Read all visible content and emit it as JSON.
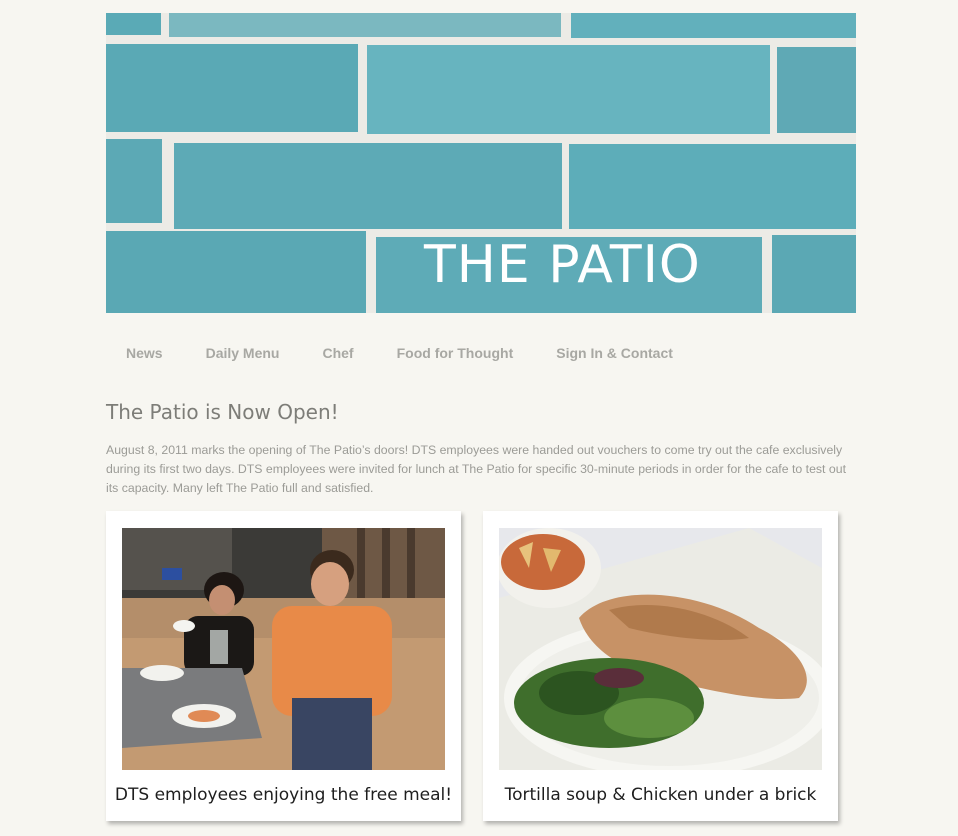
{
  "header": {
    "banner_title": "THE PATIO"
  },
  "nav": {
    "items": [
      {
        "label": "News"
      },
      {
        "label": "Daily Menu"
      },
      {
        "label": "Chef"
      },
      {
        "label": "Food for Thought"
      },
      {
        "label": "Sign In & Contact"
      }
    ]
  },
  "post": {
    "title": "The Patio is Now Open!",
    "body": "August 8, 2011 marks the opening of The Patio’s doors! DTS employees were handed out vouchers to come try out the cafe exclusively during its first two days. DTS employees were invited for lunch at The Patio for specific 30-minute periods in order for the cafe to test out its capacity. Many left The Patio full and satisfied."
  },
  "photos": [
    {
      "caption": "DTS employees enjoying the free meal!"
    },
    {
      "caption": "Tortilla soup & Chicken under a brick"
    }
  ],
  "colors": {
    "background": "#f7f6f1",
    "brick": "#5fb0bd",
    "mortar": "#ecebe6",
    "nav_text": "#a8a8a3",
    "title_text": "#7d7d78",
    "body_text": "#9b9b96"
  }
}
